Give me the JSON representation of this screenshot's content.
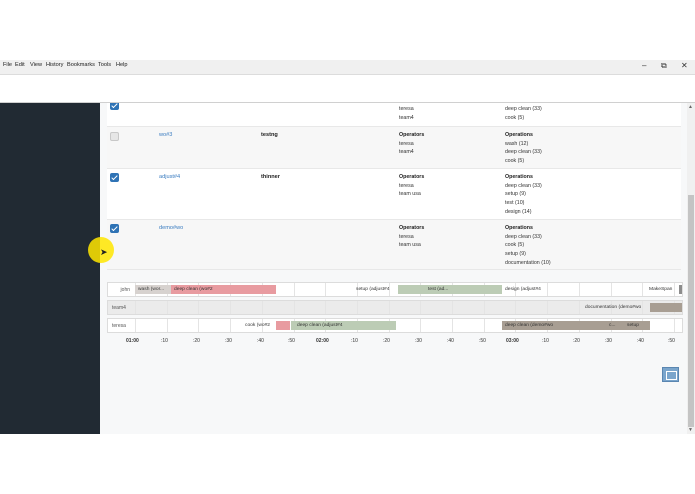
{
  "menubar": {
    "items": [
      "File",
      "Edit",
      "View",
      "History",
      "Bookmarks",
      "Tools",
      "Help"
    ],
    "window_controls": [
      "–",
      "⧉",
      "✕"
    ]
  },
  "table": {
    "rows": [
      {
        "checked": true,
        "link": "",
        "name": "",
        "operators_header": "",
        "operators": [
          "teresa",
          "team4"
        ],
        "operations_header": "",
        "operations": [
          "deep clean (33)",
          "cook (5)"
        ]
      },
      {
        "checked": false,
        "link": "wo#3",
        "name": "testng",
        "operators_header": "Operators",
        "operators": [
          "teresa",
          "team4"
        ],
        "operations_header": "Operations",
        "operations": [
          "wash (12)",
          "deep clean (33)",
          "cook (5)"
        ]
      },
      {
        "checked": true,
        "link": "adjust#4",
        "name": "thinner",
        "operators_header": "Operators",
        "operators": [
          "teresa",
          "team usa"
        ],
        "operations_header": "Operations",
        "operations": [
          "deep clean (33)",
          "setup (9)",
          "test (10)",
          "design (14)"
        ]
      },
      {
        "checked": true,
        "link": "demo#wo",
        "name": "",
        "operators_header": "Operators",
        "operators": [
          "teresa",
          "team usa"
        ],
        "operations_header": "Operations",
        "operations": [
          "deep clean (33)",
          "cook (5)",
          "setup (9)",
          "documentation (10)"
        ]
      }
    ]
  },
  "gantt": {
    "rows": [
      {
        "label": "john",
        "bars": [
          {
            "label": "wash (wor...",
            "color": "grey"
          },
          {
            "label": "deep clean (wo#2",
            "color": "pink"
          },
          {
            "label": "setup (adjust#4",
            "color": "none"
          },
          {
            "label": "test (ad...",
            "color": "green"
          },
          {
            "label": "design (adjust#4",
            "color": "none"
          },
          {
            "label": "MakeSpan",
            "color": "none"
          }
        ]
      },
      {
        "label": "team4",
        "bars": [
          {
            "label": "documentation (demo#wo",
            "color": "brown"
          }
        ]
      },
      {
        "label": "teresa",
        "bars": [
          {
            "label": "cook (wo#2",
            "color": "none"
          },
          {
            "label": "",
            "color": "pink"
          },
          {
            "label": "deep clean (adjust#4",
            "color": "green"
          },
          {
            "label": "deep clean (demo#wo",
            "color": "brown"
          },
          {
            "label": "c...",
            "color": "brown"
          },
          {
            "label": "setup",
            "color": "brown"
          }
        ]
      }
    ],
    "axis": [
      "01:00",
      ":10",
      ":20",
      ":30",
      ":40",
      ":50",
      "02:00",
      ":10",
      ":20",
      ":30",
      ":40",
      ":50",
      "03:00",
      ":10",
      ":20",
      ":30",
      ":40",
      ":50"
    ]
  },
  "colors": {
    "sidebar": "#212a33",
    "link": "#3a7cc0",
    "checkbox": "#2f73b5",
    "bar_pink": "#e89ba0",
    "bar_green": "#bcccb5",
    "bar_brown": "#a89e93"
  },
  "icons": [
    "checkbox-icon",
    "fullscreen-icon",
    "cursor-highlight"
  ]
}
